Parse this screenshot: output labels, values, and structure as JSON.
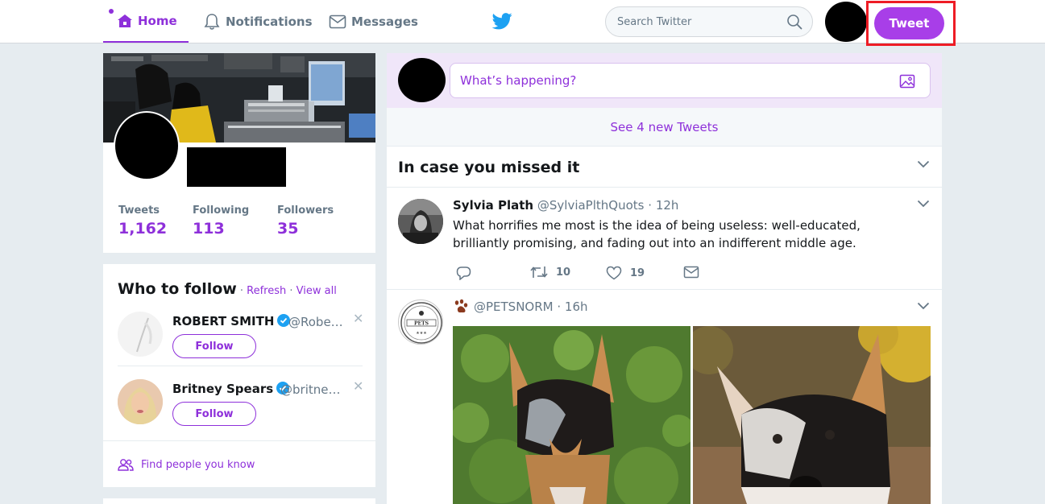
{
  "nav": {
    "home": "Home",
    "notifications": "Notifications",
    "messages": "Messages",
    "search_placeholder": "Search Twitter",
    "tweet_button": "Tweet"
  },
  "profile": {
    "stats": [
      {
        "label": "Tweets",
        "value": "1,162"
      },
      {
        "label": "Following",
        "value": "113"
      },
      {
        "label": "Followers",
        "value": "35"
      }
    ]
  },
  "who_to_follow": {
    "title": "Who to follow",
    "refresh": "Refresh",
    "view_all": "View all",
    "separator": "·",
    "suggestions": [
      {
        "name": "ROBERT SMITH",
        "handle": "@Robe…",
        "follow": "Follow"
      },
      {
        "name": "Britney Spears",
        "handle": "@britne…",
        "follow": "Follow"
      }
    ],
    "find_people": "Find people you know"
  },
  "timeline": {
    "compose_placeholder": "What’s happening?",
    "new_tweets": "See 4 new Tweets",
    "section_title": "In case you missed it",
    "tweets": [
      {
        "name": "Sylvia Plath",
        "handle": "@SylviaPlthQuots",
        "time": "12h",
        "text": "What horrifies me most is the idea of being useless: well-educated, brilliantly promising, and fading out into an indifferent middle age.",
        "retweets": "10",
        "likes": "19"
      },
      {
        "handle": "@PETSNORM",
        "time": "16h",
        "avatar_text": "PETS"
      }
    ]
  },
  "colors": {
    "accent": "#8e30da",
    "tweet_button": "#a83ee8",
    "highlight_box": "#ee1c25",
    "background": "#e6ecf0"
  }
}
